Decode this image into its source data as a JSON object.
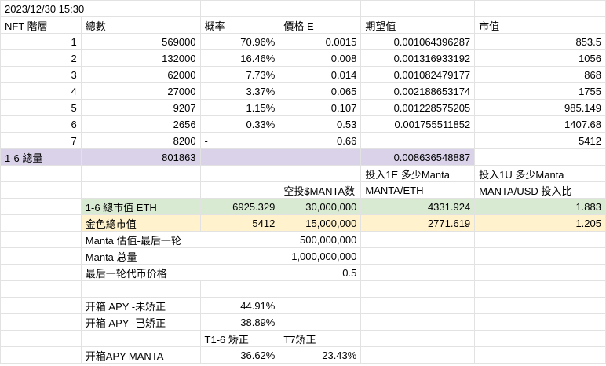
{
  "timestamp": "2023/12/30 15:30",
  "headers": {
    "tier": "NFT 階層",
    "total": "總數",
    "prob": "概率",
    "price": "價格 E",
    "expected": "期望值",
    "market_value": "市值"
  },
  "tiers": [
    {
      "tier": "1",
      "total": "569000",
      "prob": "70.96%",
      "price": "0.0015",
      "expected": "0.001064396287",
      "market_value": "853.5"
    },
    {
      "tier": "2",
      "total": "132000",
      "prob": "16.46%",
      "price": "0.008",
      "expected": "0.001316933192",
      "market_value": "1056"
    },
    {
      "tier": "3",
      "total": "62000",
      "prob": "7.73%",
      "price": "0.014",
      "expected": "0.001082479177",
      "market_value": "868"
    },
    {
      "tier": "4",
      "total": "27000",
      "prob": "3.37%",
      "price": "0.065",
      "expected": "0.002188653174",
      "market_value": "1755"
    },
    {
      "tier": "5",
      "total": "9207",
      "prob": "1.15%",
      "price": "0.107",
      "expected": "0.001228575205",
      "market_value": "985.149"
    },
    {
      "tier": "6",
      "total": "2656",
      "prob": "0.33%",
      "price": "0.53",
      "expected": "0.001755511852",
      "market_value": "1407.68"
    },
    {
      "tier": "7",
      "total": "8200",
      "prob": "-",
      "price": "0.66",
      "expected": "",
      "market_value": "5412"
    }
  ],
  "total_row": {
    "label": "1-6 總量",
    "total": "801863",
    "expected": "0.008636548887"
  },
  "invest_headers": {
    "per_eth": "投入1E 多少Manta",
    "per_usd": "投入1U 多少Manta"
  },
  "unit_headers": {
    "airdrop": "空投$MANTA数",
    "manta_eth": "MANTA/ETH",
    "manta_usd": "MANTA/USD 投入比"
  },
  "green_row": {
    "label": "1-6 總市值 ETH",
    "value": "6925.329",
    "airdrop": "30,000,000",
    "manta_eth": "4331.924",
    "ratio": "1.883"
  },
  "yellow_row": {
    "label": "金色總市值",
    "value": "5412",
    "airdrop": "15,000,000",
    "manta_eth": "2771.619",
    "ratio": "1.205"
  },
  "manta_info": [
    {
      "label": "Manta 估值-最后一轮",
      "value": "500,000,000"
    },
    {
      "label": "Manta 总量",
      "value": "1,000,000,000"
    },
    {
      "label": "最后一轮代币价格",
      "value": "0.5"
    }
  ],
  "apy": {
    "uncorrected_label": "开箱 APY -未矫正",
    "uncorrected": "44.91%",
    "corrected_label": "开箱 APY -已矫正",
    "corrected": "38.89%",
    "t16_header": "T1-6 矫正",
    "t7_header": "T7矫正",
    "manta_label": "开箱APY-MANTA",
    "manta_t16": "36.62%",
    "manta_t7": "23.43%"
  }
}
